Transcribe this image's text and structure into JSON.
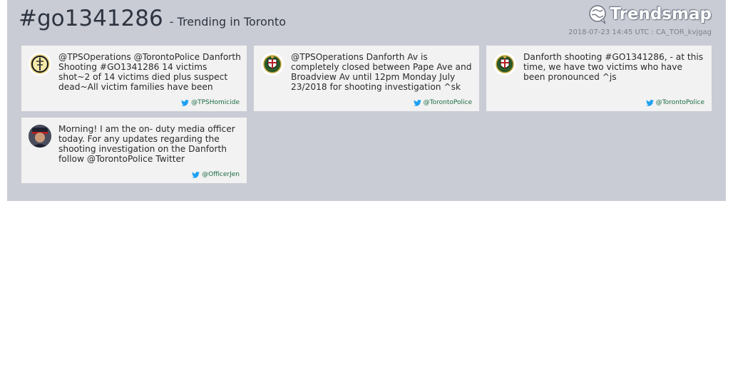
{
  "header": {
    "hashtag": "#go1341286",
    "subtitle": "- Trending in Toronto",
    "logo_text": "Trendsmap",
    "meta": "2018-07-23 14:45 UTC : CA_TOR_kvjgag"
  },
  "tweets": [
    {
      "text": "@TPSOperations @TorontoPolice Danforth Shooting #GO1341286 14 victims shot~2 of 14 victims died plus suspect dead~All victim families have been notified ^ks",
      "author": "@TPSHomicide",
      "avatar_icon": "tps-homicide-badge-icon"
    },
    {
      "text": "@TPSOperations Danforth Av is completely closed between Pape Ave and Broadview Av until 12pm Monday July 23/2018 for shooting investigation ^sk",
      "author": "@TorontoPolice",
      "avatar_icon": "toronto-police-crest-icon"
    },
    {
      "text": "Danforth shooting #GO1341286, - at this time, we have two victims who have been pronounced ^js",
      "author": "@TorontoPolice",
      "avatar_icon": "toronto-police-crest-icon"
    },
    {
      "text": "Morning! I am the on- duty media officer today. For any updates regarding the shooting investigation on the Danforth follow @TorontoPolice Twitter",
      "author": "@OfficerJen",
      "avatar_icon": "officer-photo-icon"
    }
  ],
  "colors": {
    "panel": "#c9ccd4",
    "card": "#f2f2f2",
    "author_link": "#1a6b43",
    "twitter_bird": "#1da1f2"
  }
}
